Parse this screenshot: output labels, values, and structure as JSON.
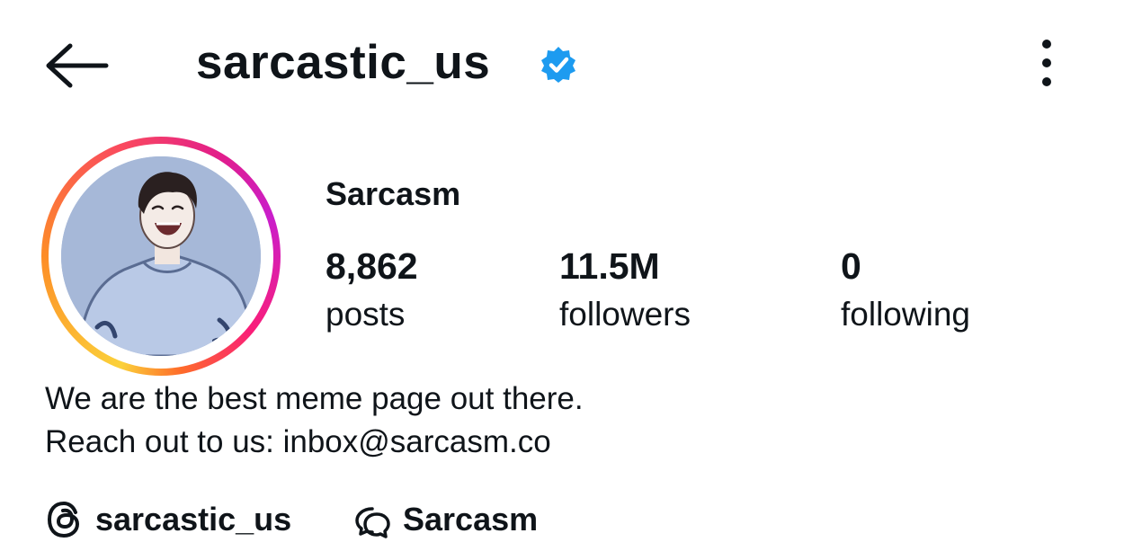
{
  "header": {
    "username": "sarcastic_us",
    "verified": true,
    "icons": {
      "back": "arrow-left-icon",
      "verified": "verified-badge-icon",
      "more": "more-vertical-icon"
    }
  },
  "profile": {
    "display_name": "Sarcasm",
    "has_story_ring": true,
    "stats": [
      {
        "value": "8,862",
        "label": "posts"
      },
      {
        "value": "11.5M",
        "label": "followers"
      },
      {
        "value": "0",
        "label": "following"
      }
    ],
    "bio": [
      "We are the best meme page out there.",
      "Reach out to us: inbox@sarcasm.co"
    ]
  },
  "links": [
    {
      "icon": "threads-icon",
      "label": "sarcastic_us"
    },
    {
      "icon": "chat-bubbles-icon",
      "label": "Sarcasm"
    }
  ],
  "colors": {
    "verified_blue": "#1d9bf0",
    "text": "#0f1419",
    "story_ring": [
      "#fbd13a",
      "#fd8d27",
      "#fa4a5e",
      "#e21d8a",
      "#c91ecb"
    ]
  }
}
